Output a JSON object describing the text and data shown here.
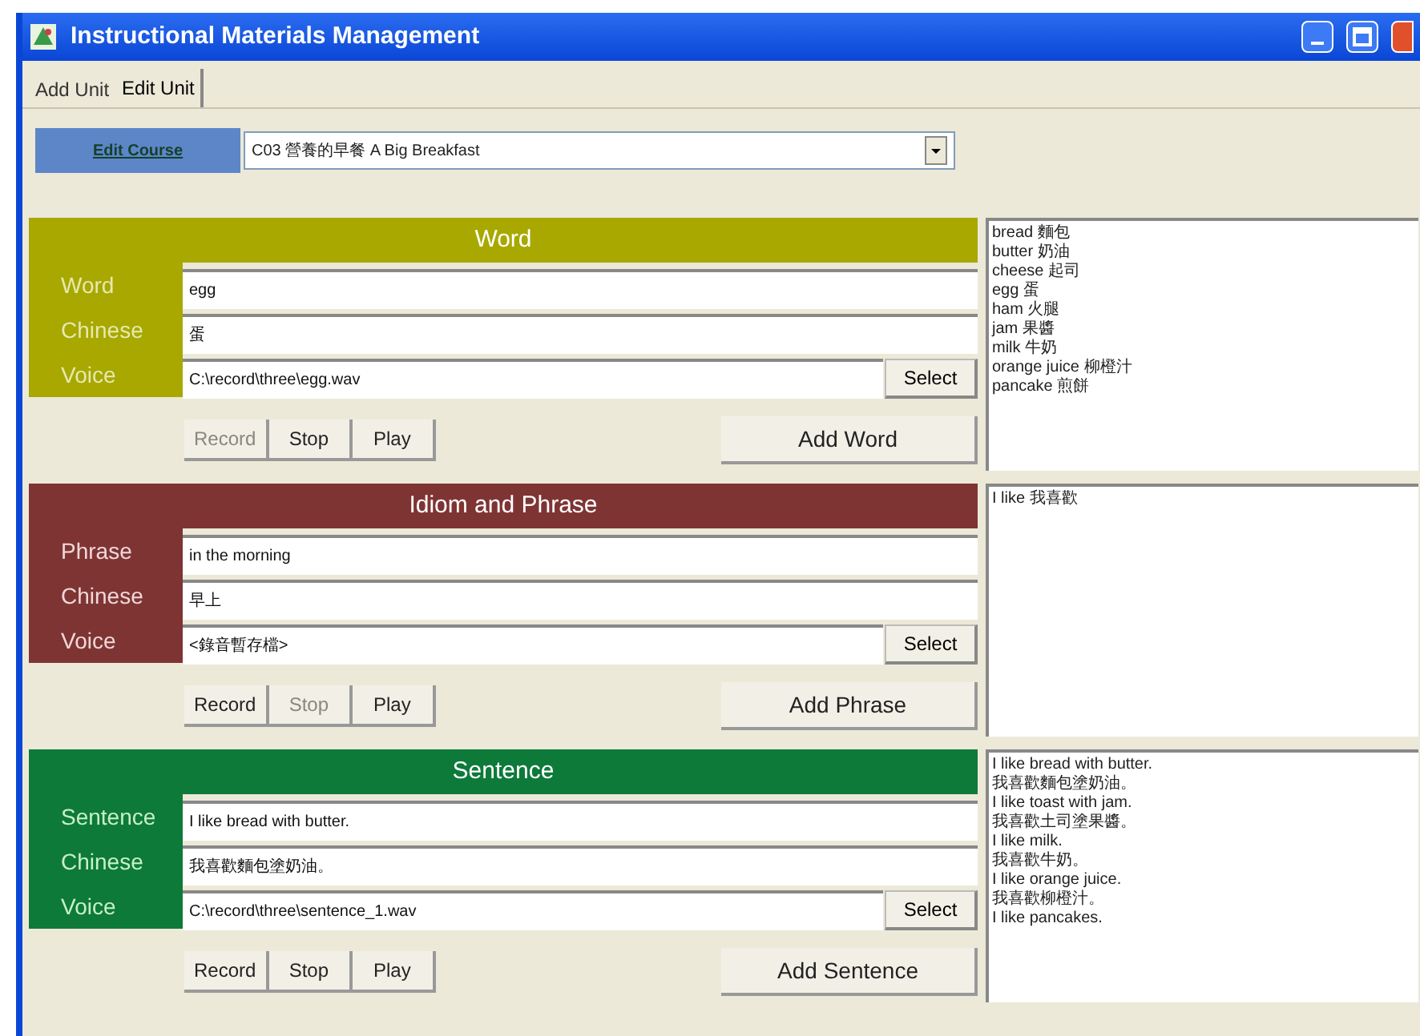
{
  "window": {
    "title": "Instructional Materials Management"
  },
  "tabs": [
    {
      "label": "Add Unit",
      "selected": false
    },
    {
      "label": "Edit Unit",
      "selected": true
    }
  ],
  "course": {
    "button": "Edit Course",
    "value": "C03 營養的早餐 A Big Breakfast"
  },
  "sections": [
    {
      "title": "Word",
      "color": "#a8a800",
      "fields": [
        {
          "label": "Word",
          "value": "egg"
        },
        {
          "label": "Chinese",
          "value": "蛋"
        },
        {
          "label": "Voice",
          "value": "C:\\record\\three\\egg.wav",
          "select": "Select"
        }
      ],
      "buttons": [
        {
          "label": "Record",
          "disabled": true
        },
        {
          "label": "Stop",
          "disabled": false
        },
        {
          "label": "Play",
          "disabled": false
        }
      ],
      "add": "Add Word",
      "list": [
        "bread 麵包",
        "butter 奶油",
        "cheese 起司",
        "egg 蛋",
        "ham 火腿",
        "jam 果醬",
        "milk 牛奶",
        "orange juice 柳橙汁",
        "pancake 煎餅"
      ]
    },
    {
      "title": "Idiom and Phrase",
      "color": "#7f3434",
      "fields": [
        {
          "label": "Phrase",
          "value": "in the morning"
        },
        {
          "label": "Chinese",
          "value": "早上"
        },
        {
          "label": "Voice",
          "value": "<錄音暫存檔>",
          "select": "Select"
        }
      ],
      "buttons": [
        {
          "label": "Record",
          "disabled": false
        },
        {
          "label": "Stop",
          "disabled": true
        },
        {
          "label": "Play",
          "disabled": false
        }
      ],
      "add": "Add Phrase",
      "list": [
        "I like 我喜歡"
      ]
    },
    {
      "title": "Sentence",
      "color": "#0d7a3a",
      "fields": [
        {
          "label": "Sentence",
          "value": "I like bread with butter."
        },
        {
          "label": "Chinese",
          "value": "我喜歡麵包塗奶油。"
        },
        {
          "label": "Voice",
          "value": "C:\\record\\three\\sentence_1.wav",
          "select": "Select"
        }
      ],
      "buttons": [
        {
          "label": "Record",
          "disabled": false
        },
        {
          "label": "Stop",
          "disabled": false
        },
        {
          "label": "Play",
          "disabled": false
        }
      ],
      "add": "Add Sentence",
      "list": [
        "I like bread with butter.",
        "我喜歡麵包塗奶油。",
        "I like toast with jam.",
        "我喜歡土司塗果醬。",
        "I like milk.",
        "我喜歡牛奶。",
        "I like orange juice.",
        "我喜歡柳橙汁。",
        "I like pancakes."
      ]
    }
  ]
}
